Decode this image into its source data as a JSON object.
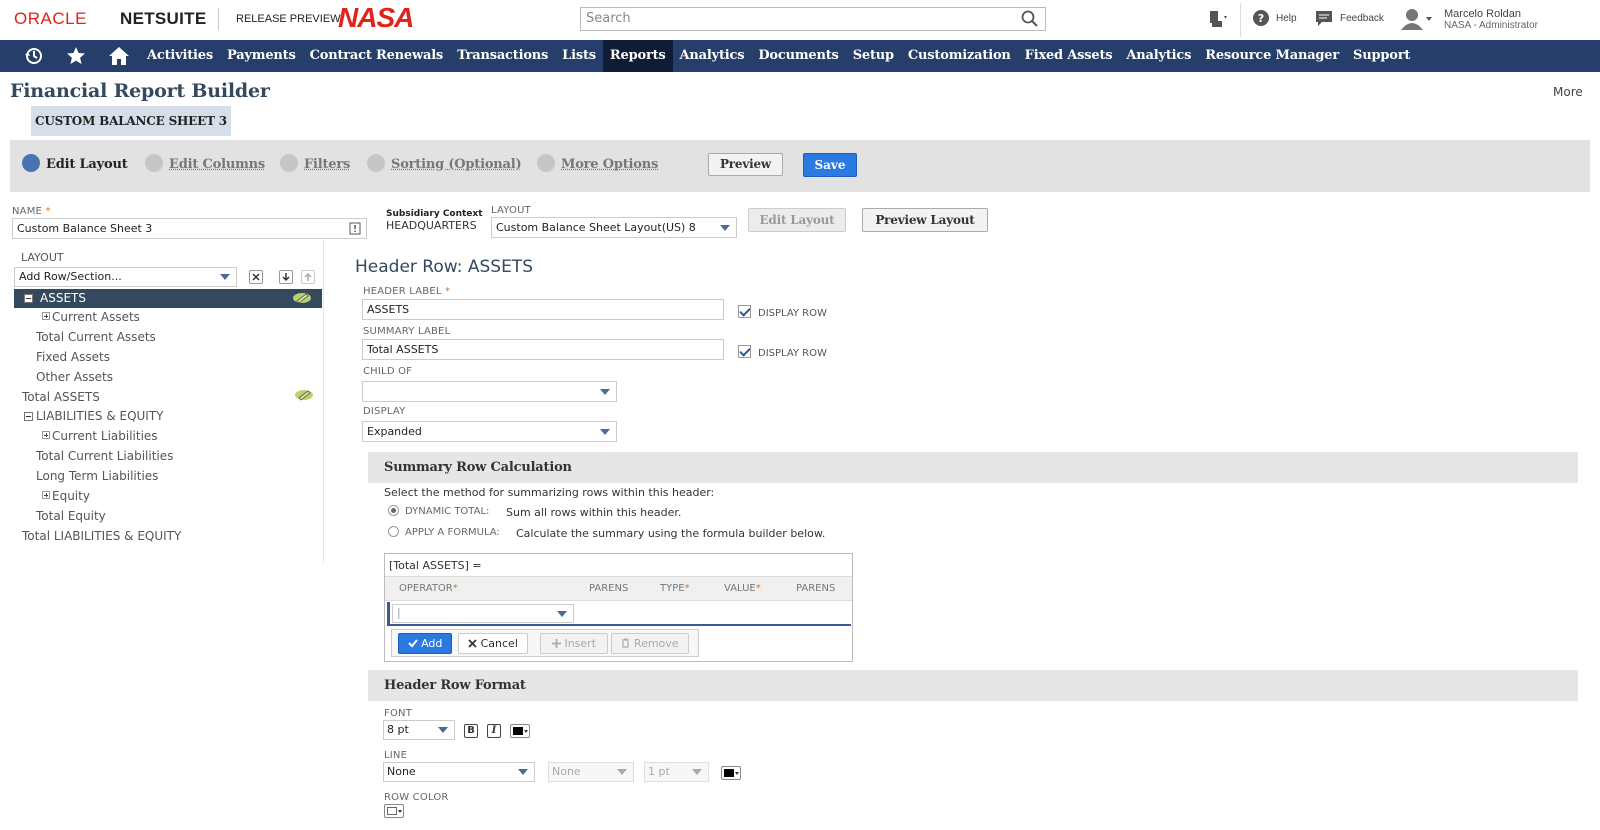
{
  "header": {
    "oracle": "ORACLE",
    "netsuite": "NETSUITE",
    "release_preview": "RELEASE PREVIEW",
    "nasa": "NASA",
    "search_placeholder": "Search",
    "help": "Help",
    "feedback": "Feedback",
    "user_name": "Marcelo Roldan",
    "user_role": "NASA - Administrator"
  },
  "nav": {
    "items": [
      "Activities",
      "Payments",
      "Contract Renewals",
      "Transactions",
      "Lists",
      "Reports",
      "Analytics",
      "Documents",
      "Setup",
      "Customization",
      "Fixed Assets",
      "Analytics",
      "Resource Manager",
      "Support"
    ],
    "active": "Reports"
  },
  "page": {
    "title": "Financial Report Builder",
    "more": "More",
    "report_name_tag": "CUSTOM BALANCE SHEET 3"
  },
  "steps": {
    "edit_layout": "Edit Layout",
    "edit_columns": "Edit Columns",
    "filters": "Filters",
    "sorting": "Sorting (Optional)",
    "more_options": "More Options",
    "preview": "Preview",
    "save": "Save"
  },
  "fields": {
    "name_label": "NAME",
    "name_value": "Custom Balance Sheet 3",
    "subsidiary_label": "Subsidiary Context",
    "subsidiary_value": "HEADQUARTERS",
    "layout_label": "LAYOUT",
    "layout_value": "Custom Balance Sheet Layout(US) 8",
    "edit_layout_btn": "Edit Layout",
    "preview_layout_btn": "Preview Layout",
    "required_mark": "*"
  },
  "layout_tree": {
    "title": "LAYOUT",
    "add_row_placeholder": "Add Row/Section...",
    "items": {
      "assets": "ASSETS",
      "current_assets": "Current Assets",
      "total_current_assets": "Total Current Assets",
      "fixed_assets": "Fixed Assets",
      "other_assets": "Other Assets",
      "total_assets": "Total ASSETS",
      "liabilities_equity": "LIABILITIES & EQUITY",
      "current_liabilities": "Current Liabilities",
      "total_current_liabilities": "Total Current Liabilities",
      "long_term_liabilities": "Long Term Liabilities",
      "equity": "Equity",
      "total_equity": "Total Equity",
      "total_liabilities_equity": "Total LIABILITIES & EQUITY"
    }
  },
  "header_row": {
    "title": "Header Row: ASSETS",
    "header_label_label": "HEADER LABEL",
    "header_label_value": "ASSETS",
    "display_row": "DISPLAY ROW",
    "summary_label_label": "SUMMARY LABEL",
    "summary_label_value": "Total ASSETS",
    "child_of_label": "CHILD OF",
    "child_of_value": "",
    "display_label": "DISPLAY",
    "display_value": "Expanded"
  },
  "summary_calc": {
    "title": "Summary Row Calculation",
    "instruction": "Select the method for summarizing rows within this header:",
    "dynamic_label": "DYNAMIC TOTAL:",
    "dynamic_desc": "Sum all rows within this header.",
    "formula_label": "APPLY A FORMULA:",
    "formula_desc": "Calculate the summary using the formula builder below.",
    "formula_expr": "[Total ASSETS] =",
    "columns": [
      "OPERATOR",
      "PARENS",
      "TYPE",
      "VALUE",
      "PARENS"
    ],
    "add": "Add",
    "cancel": "Cancel",
    "insert": "Insert",
    "remove": "Remove"
  },
  "format": {
    "title": "Header Row Format",
    "font_label": "FONT",
    "font_size": "8 pt",
    "bold": "B",
    "italic": "I",
    "line_label": "LINE",
    "line_value": "None",
    "line_style": "None",
    "line_weight": "1 pt",
    "row_color_label": "ROW COLOR"
  },
  "colors": {
    "nav_bg": "#263e6a",
    "nav_active": "#0e1c36",
    "accent_blue": "#2a7ae2",
    "brand_red": "#e2231a"
  }
}
